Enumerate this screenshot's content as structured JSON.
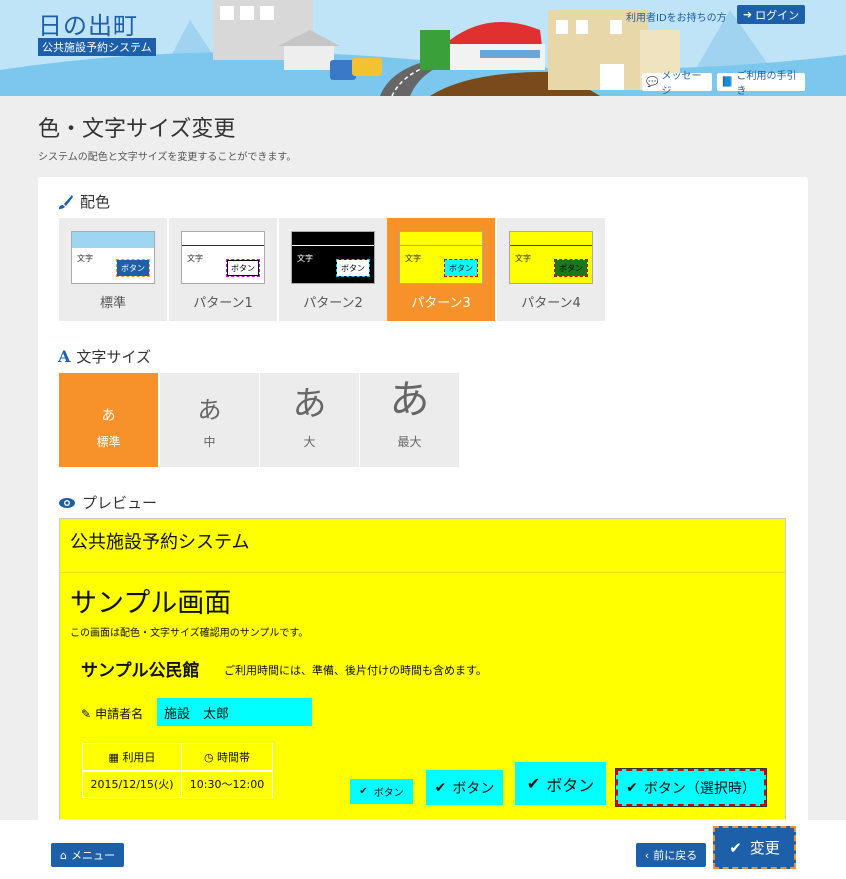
{
  "header": {
    "app_title": "日の出町",
    "app_subtitle": "公共施設予約システム",
    "login_prompt": "利用者IDをお持ちの方",
    "login_button": "ログイン",
    "message_link": "メッセージ",
    "guide_link": "ご利用の手引き"
  },
  "page": {
    "title": "色・文字サイズ変更",
    "description": "システムの配色と文字サイズを変更することができます。"
  },
  "color_section": {
    "heading": "配色",
    "icon": "paintbrush-icon",
    "swatch_text": "文字",
    "swatch_button": "ボタン",
    "options": [
      {
        "label": "標準",
        "selected": false
      },
      {
        "label": "パターン1",
        "selected": false
      },
      {
        "label": "パターン2",
        "selected": false
      },
      {
        "label": "パターン3",
        "selected": true
      },
      {
        "label": "パターン4",
        "selected": false
      }
    ]
  },
  "size_section": {
    "heading": "文字サイズ",
    "icon": "font-icon",
    "glyph": "あ",
    "options": [
      {
        "label": "標準",
        "selected": true
      },
      {
        "label": "中",
        "selected": false
      },
      {
        "label": "大",
        "selected": false
      },
      {
        "label": "最大",
        "selected": false
      }
    ]
  },
  "preview_section": {
    "heading": "プレビュー",
    "icon": "eye-icon",
    "header_text": "公共施設予約システム",
    "title": "サンプル画面",
    "description": "この画面は配色・文字サイズ確認用のサンプルです。",
    "facility_name": "サンプル公民館",
    "facility_note": "ご利用時間には、準備、後片付けの時間も含めます。",
    "applicant_label": "申請者名",
    "applicant_value": "施設　太郎",
    "table": {
      "headers": [
        "利用日",
        "時間帯"
      ],
      "row": [
        "2015/12/15(火)",
        "10:30～12:00"
      ]
    },
    "buttons": [
      "ボタン",
      "ボタン",
      "ボタン",
      "ボタン（選択時）"
    ],
    "colors": {
      "background": "#ffff00",
      "button": "#00ffff",
      "selected_outline": "#cc0000"
    }
  },
  "footer": {
    "menu_button": "メニュー",
    "back_button": "前に戻る",
    "submit_button": "変更"
  },
  "colors": {
    "primary": "#1d5fa8",
    "accent": "#f7922a",
    "panel_gray": "#ececec"
  }
}
